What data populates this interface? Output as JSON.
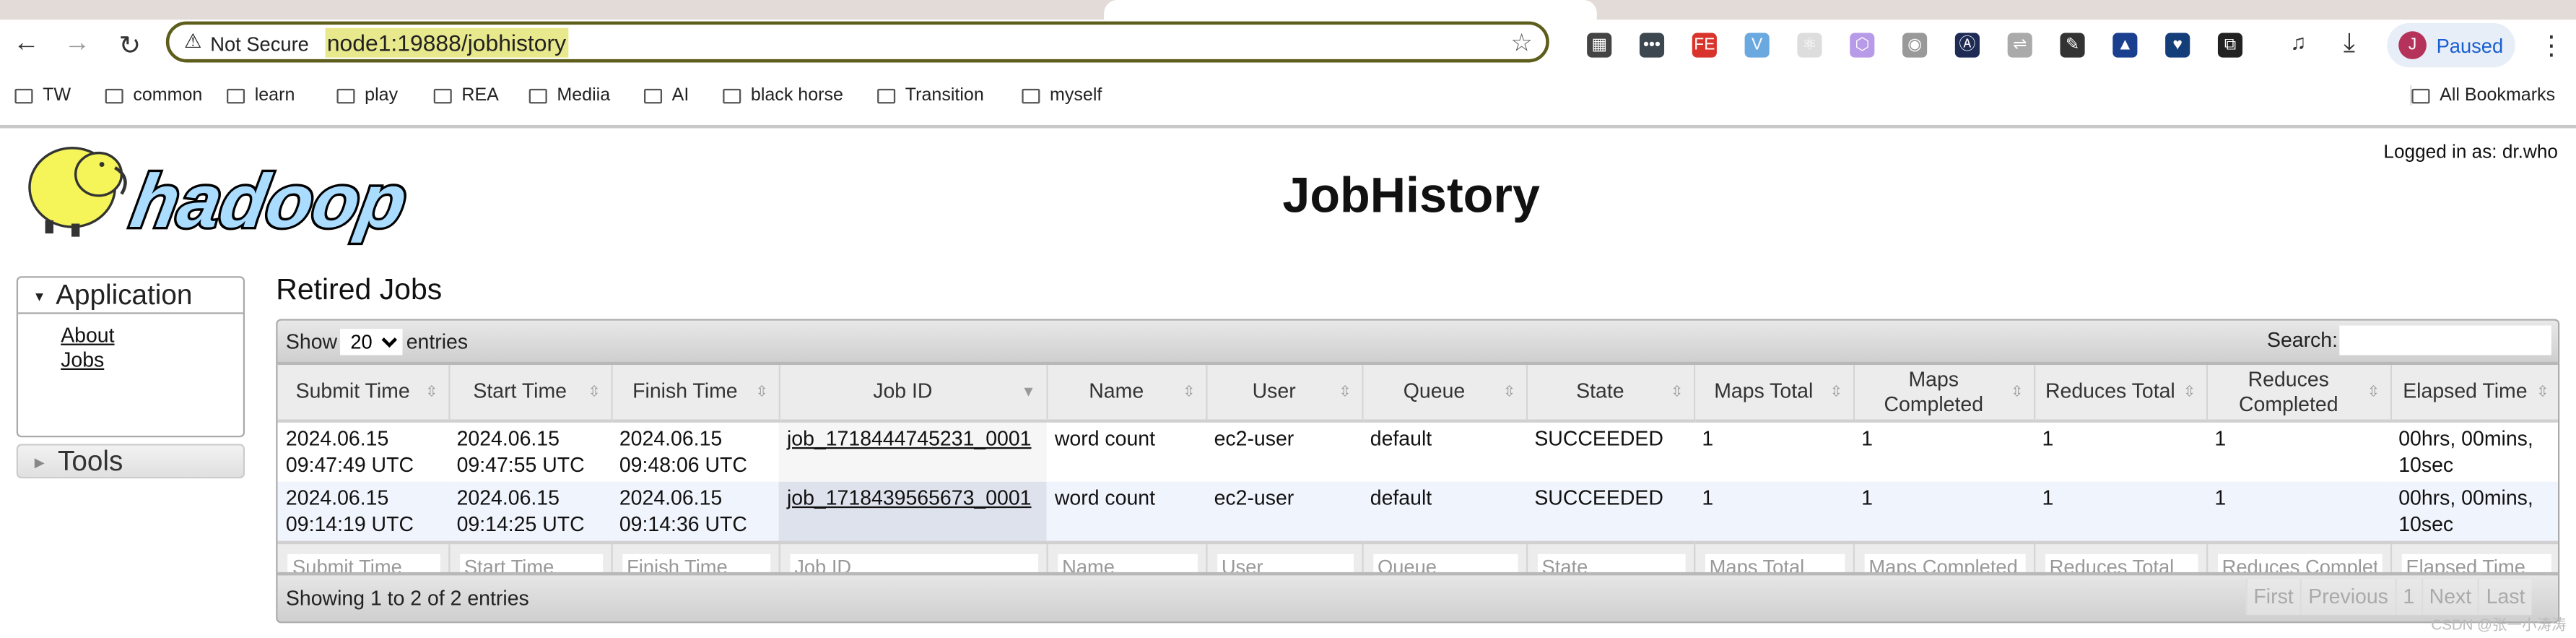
{
  "browser": {
    "security_label": "Not Secure",
    "url": "node1:19888/jobhistory",
    "profile_initial": "J",
    "profile_status": "Paused",
    "bookmarks": [
      "TW",
      "common",
      "learn",
      "play",
      "REA",
      "Mediia",
      "AI",
      "black horse",
      "Transition",
      "myself"
    ],
    "all_bookmarks": "All Bookmarks",
    "extensions": [
      {
        "name": "qr-code-icon",
        "glyph": "▦",
        "color": "#444"
      },
      {
        "name": "dots-extension-icon",
        "glyph": "•••",
        "color": "#3d4750"
      },
      {
        "name": "fe-extension-icon",
        "glyph": "FE",
        "color": "#d9342b"
      },
      {
        "name": "v-extension-icon",
        "glyph": "V",
        "color": "#6aa8e0"
      },
      {
        "name": "react-extension-icon",
        "glyph": "⚛",
        "color": "#ddd"
      },
      {
        "name": "hex-extension-icon",
        "glyph": "⬡",
        "color": "#b89be8"
      },
      {
        "name": "camera-icon",
        "glyph": "◉",
        "color": "#999"
      },
      {
        "name": "a-circle-icon",
        "glyph": "Ⓐ",
        "color": "#1d2b55"
      },
      {
        "name": "link-icon",
        "glyph": "⇌",
        "color": "#aaa"
      },
      {
        "name": "pin-icon",
        "glyph": "✎",
        "color": "#333"
      },
      {
        "name": "drop-icon",
        "glyph": "▲",
        "color": "#1b3f8f"
      },
      {
        "name": "heart-pin-icon",
        "glyph": "♥",
        "color": "#143e7a"
      },
      {
        "name": "puzzle-icon",
        "glyph": "⧉",
        "color": "#222"
      }
    ]
  },
  "header": {
    "logo_text": "hadoop",
    "title": "JobHistory",
    "logged_in": "Logged in as: dr.who"
  },
  "sidebar": {
    "application": "Application",
    "links": [
      "About",
      "Jobs"
    ],
    "tools": "Tools"
  },
  "main": {
    "heading": "Retired Jobs",
    "show_label": "Show",
    "entries_value": "20",
    "entries_label": "entries",
    "search_label": "Search:",
    "columns": [
      "Submit Time",
      "Start Time",
      "Finish Time",
      "Job ID",
      "Name",
      "User",
      "Queue",
      "State",
      "Maps Total",
      "Maps Completed",
      "Reduces Total",
      "Reduces Completed",
      "Elapsed Time"
    ],
    "sorted_column": "Job ID",
    "rows": [
      [
        "2024.06.15 09:47:49 UTC",
        "2024.06.15 09:47:55 UTC",
        "2024.06.15 09:48:06 UTC",
        "job_1718444745231_0001",
        "word count",
        "ec2-user",
        "default",
        "SUCCEEDED",
        "1",
        "1",
        "1",
        "1",
        "00hrs, 00mins, 10sec"
      ],
      [
        "2024.06.15 09:14:19 UTC",
        "2024.06.15 09:14:25 UTC",
        "2024.06.15 09:14:36 UTC",
        "job_1718439565673_0001",
        "word count",
        "ec2-user",
        "default",
        "SUCCEEDED",
        "1",
        "1",
        "1",
        "1",
        "00hrs, 00mins, 10sec"
      ]
    ],
    "filters": [
      "Submit Time",
      "Start Time",
      "Finish Time",
      "Job ID",
      "Name",
      "User",
      "Queue",
      "State",
      "Maps Total",
      "Maps Completed",
      "Reduces Total",
      "Reduces Complete",
      "Elapsed Time"
    ],
    "info": "Showing 1 to 2 of 2 entries",
    "pager": [
      "First",
      "Previous",
      "1",
      "Next",
      "Last"
    ]
  },
  "watermark": "CSDN @张一小涛涛"
}
